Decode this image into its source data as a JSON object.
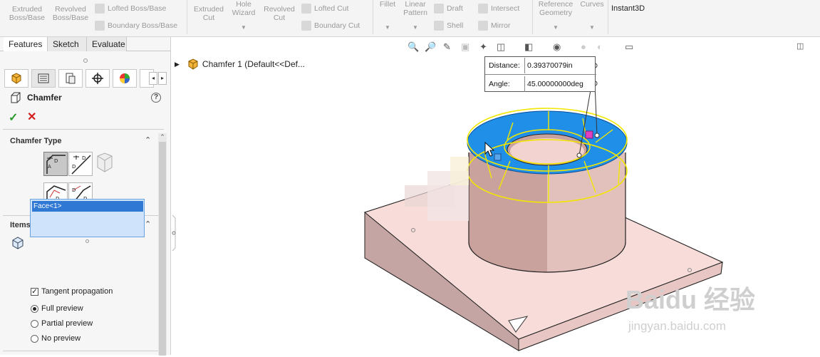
{
  "ribbon": {
    "extruded_boss": "Extruded\nBoss/Base",
    "extruded_boss_l1": "Extruded",
    "extruded_boss_l2": "Boss/Base",
    "revolved_boss_l1": "Revolved",
    "revolved_boss_l2": "Boss/Base",
    "lofted_boss": "Lofted Boss/Base",
    "boundary_boss": "Boundary Boss/Base",
    "extruded_cut_l1": "Extruded",
    "extruded_cut_l2": "Cut",
    "hole_wizard_l1": "Hole",
    "hole_wizard_l2": "Wizard",
    "revolved_cut_l1": "Revolved",
    "revolved_cut_l2": "Cut",
    "lofted_cut": "Lofted Cut",
    "boundary_cut": "Boundary Cut",
    "fillet": "Fillet",
    "linear_pattern_l1": "Linear",
    "linear_pattern_l2": "Pattern",
    "draft": "Draft",
    "intersect": "Intersect",
    "shell": "Shell",
    "mirror": "Mirror",
    "ref_geometry_l1": "Reference",
    "ref_geometry_l2": "Geometry",
    "curves": "Curves",
    "instant3d": "Instant3D"
  },
  "tabs": [
    "Features",
    "Sketch",
    "Evaluate"
  ],
  "property_manager": {
    "title": "Chamfer",
    "help_glyph": "?",
    "ok_glyph": "✓",
    "cancel_glyph": "✕"
  },
  "chamfer_type": {
    "heading": "Chamfer Type"
  },
  "items_to_chamfer": {
    "heading": "Items To Chamfer",
    "selected_item": "Face<1>",
    "tangent_propagation": "Tangent propagation",
    "tangent_propagation_checked": true,
    "preview_options": [
      "Full preview",
      "Partial preview",
      "No preview"
    ],
    "preview_selected": "Full preview"
  },
  "feature_tree": {
    "item": "Chamfer 1  (Default<<Def..."
  },
  "dimension_callout": {
    "distance_label": "Distance:",
    "distance_value": "0.39370079in",
    "angle_label": "Angle:",
    "angle_value": "45.00000000deg"
  },
  "watermark": {
    "logo_text": "Baidu 经验",
    "url": "jingyan.baidu.com"
  },
  "colors": {
    "selected_face": "#1f8fe8",
    "preview_edges": "#f2e600",
    "part_body": "#f3d3d0",
    "selection_blue": "#2f78d4"
  }
}
